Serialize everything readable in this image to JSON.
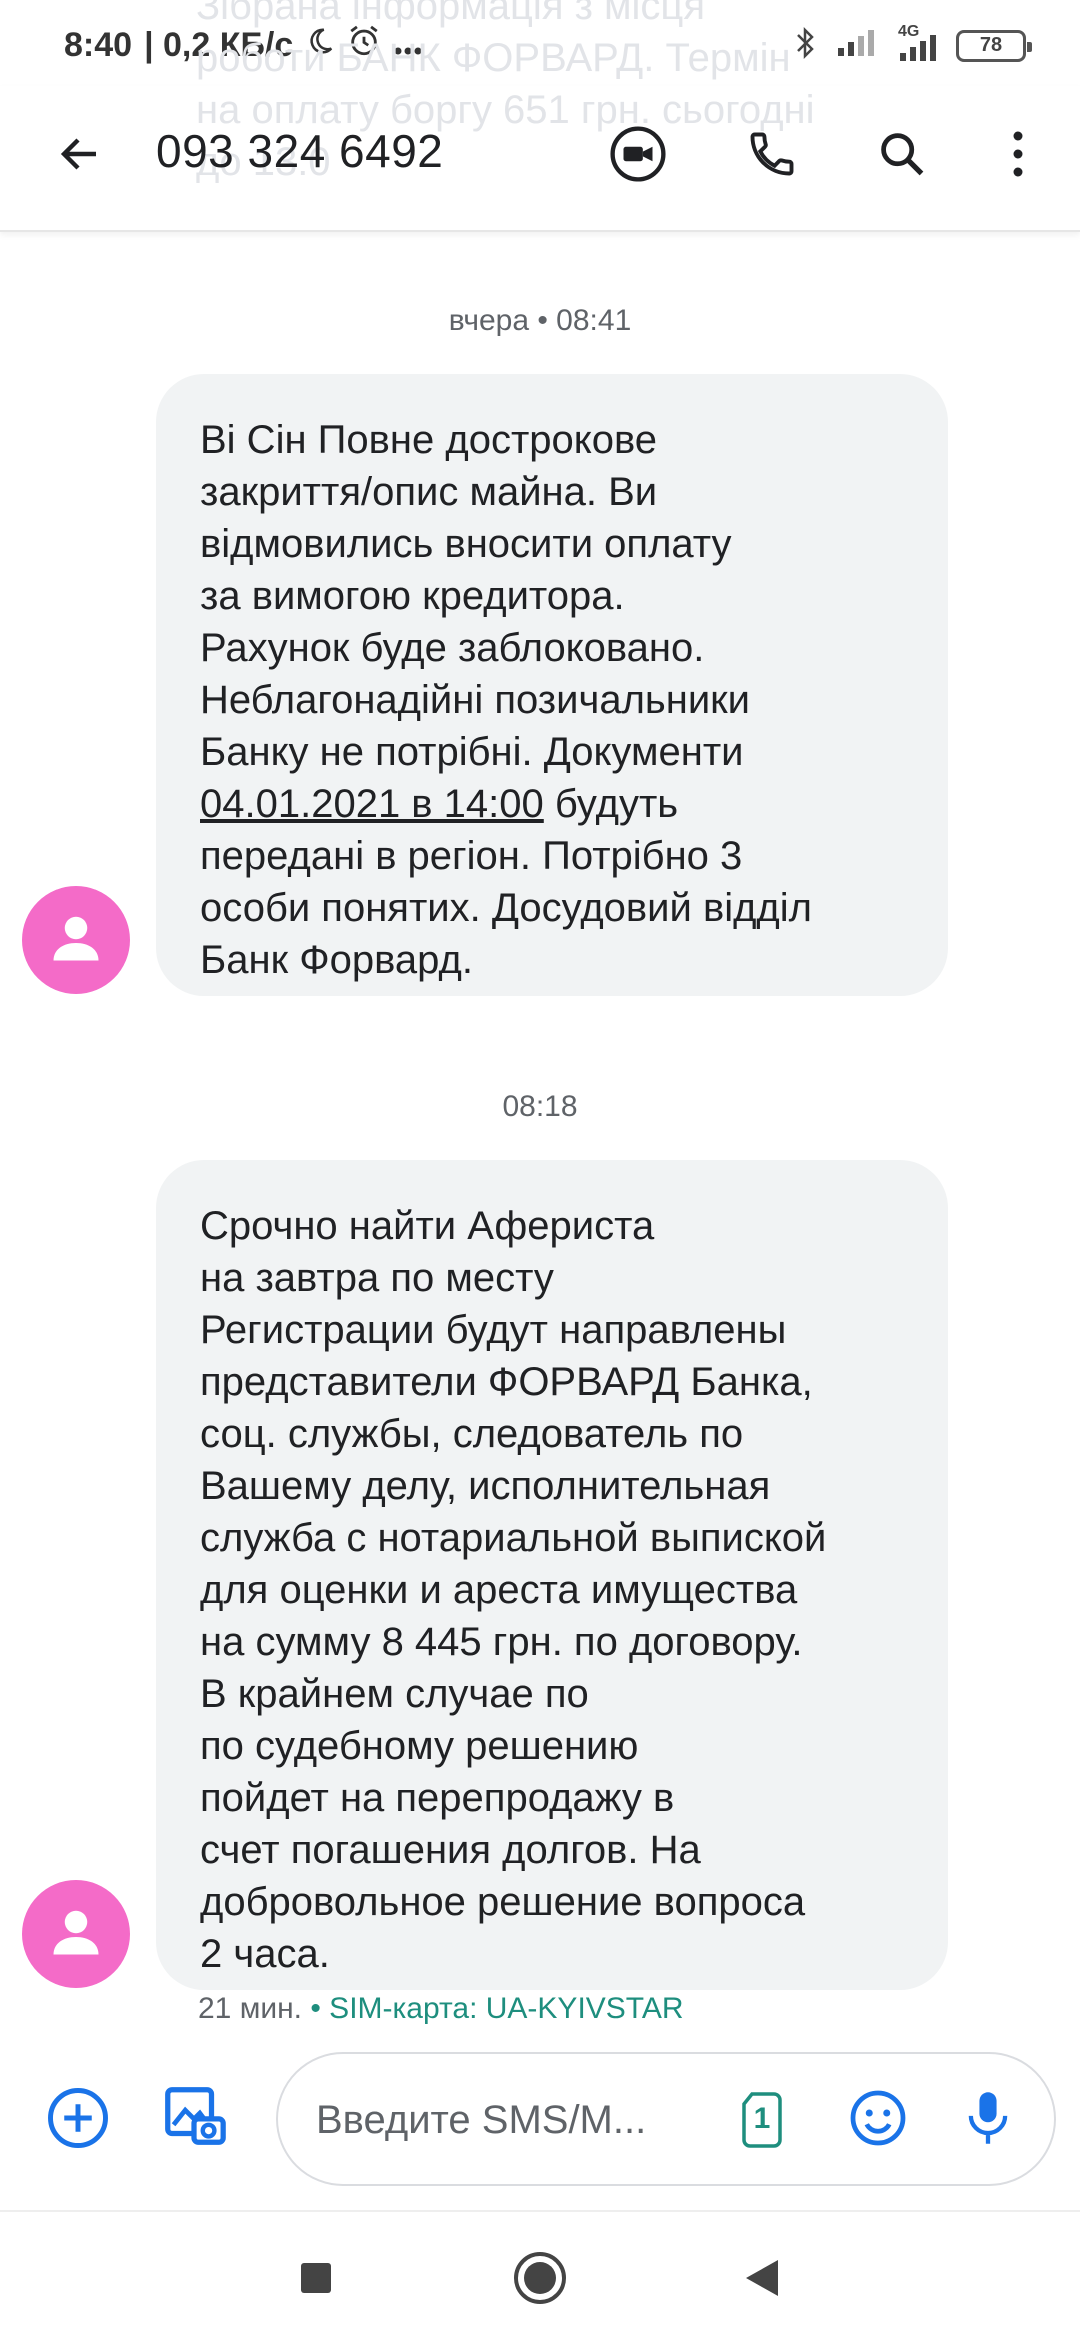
{
  "status_bar": {
    "time": "8:40",
    "speed": "| 0,2 КБ/с",
    "network": "4G",
    "battery": "78",
    "icons": [
      "moon-icon",
      "alarm-icon",
      "more-dots-icon",
      "bluetooth-icon",
      "signal-icon",
      "signal-4g-icon",
      "battery-icon"
    ]
  },
  "ghost_notification": {
    "lines": [
      "Зібрана інформація з місця",
      "роботи БАНК ФОРВАРД. Термін",
      "на оплату боргу 651 грн. сьогодні",
      "до 13:0"
    ]
  },
  "app_bar": {
    "title": "093 324 6492",
    "icons": [
      "back-arrow-icon",
      "video-call-icon",
      "phone-icon",
      "search-icon",
      "more-vert-icon"
    ]
  },
  "conversation": {
    "messages": [
      {
        "stamp": "вчера • 08:41",
        "lines": [
          "Ві                 Сін        Повне дострокове",
          "закриття/опис майна. Ви",
          "відмовились вносити оплату",
          "за вимогою кредитора.",
          "Рахунок буде заблоковано.",
          "Неблагонадійні позичальники",
          "Банку не потрібні. Документи",
          "04.01.2021 в 14:00",
          "передані в регіон. Потрібно 3",
          "особи понятих. Досудовий відділ",
          "Банк Форвард."
        ],
        "link_suffix": " будуть"
      },
      {
        "stamp": "08:18",
        "lines": [
          "Срочно найти Афериста",
          "        на завтра по месту",
          "Регистрации будут направлены",
          "представители ФОРВАРД Банка,",
          "соц. службы, следователь по",
          "Вашему делу, исполнительная",
          "служба с нотариальной выпиской",
          "для оценки и ареста имущества",
          "на сумму 8 445 грн. по договору.",
          "В крайнем случае по",
          "       по судебному решению",
          "пойдет на перепродажу в",
          "счет погашения долгов. На",
          "добровольное решение вопроса",
          "2 часа."
        ]
      }
    ],
    "meta_time": "21 мин.",
    "meta_sim": "• SIM-карта: UA-KYIVSTAR"
  },
  "composer": {
    "placeholder": "Введите SMS/M...",
    "sim_badge": "1",
    "icons": [
      "add-circle-icon",
      "gallery-icon",
      "sim-1-icon",
      "emoji-icon",
      "mic-icon"
    ]
  },
  "nav_bar": {
    "icons": [
      "recents-icon",
      "home-icon",
      "back-icon"
    ]
  },
  "colors": {
    "accent_blue": "#1a73e8",
    "avatar_pink": "#f46bc8",
    "bubble_grey": "#f1f3f4",
    "sim_teal": "#1e8e7e"
  }
}
